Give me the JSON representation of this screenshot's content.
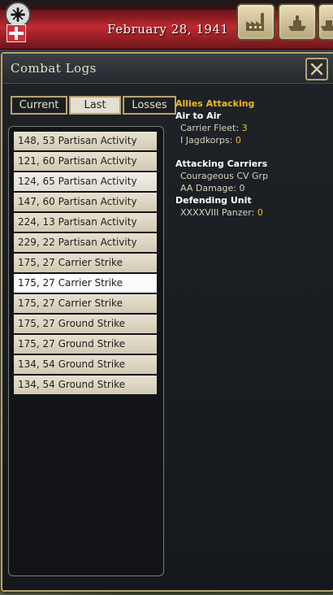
{
  "topbar": {
    "date": "February 28, 1941",
    "icons": [
      "iron-cross-icon",
      "nation-flag-icon",
      "factory-icon",
      "warship-icon",
      "ship-icon"
    ]
  },
  "panel": {
    "title": "Combat Logs",
    "close_icon": "close-x-icon"
  },
  "tabs": [
    {
      "label": "Current",
      "active": false
    },
    {
      "label": "Last",
      "active": true
    },
    {
      "label": "Losses",
      "active": false
    }
  ],
  "logs": [
    {
      "label": "148, 53 Partisan Activity"
    },
    {
      "label": "121, 60 Partisan Activity"
    },
    {
      "label": "124, 65 Partisan Activity"
    },
    {
      "label": "147, 60 Partisan Activity"
    },
    {
      "label": "224, 13 Partisan Activity"
    },
    {
      "label": "229, 22 Partisan Activity"
    },
    {
      "label": "175, 27 Carrier Strike"
    },
    {
      "label": "175, 27 Carrier Strike"
    },
    {
      "label": "175, 27 Carrier Strike"
    },
    {
      "label": "175, 27 Ground Strike"
    },
    {
      "label": "175, 27 Ground Strike"
    },
    {
      "label": "134, 54 Ground Strike"
    },
    {
      "label": "134, 54 Ground Strike"
    }
  ],
  "details": {
    "attacker": "Allies Attacking",
    "phase": "Air to Air",
    "carrier_fleet_label": "Carrier Fleet:",
    "carrier_fleet_value": "3",
    "jagdkorps_label": "I Jagdkorps:",
    "jagdkorps_value": "0",
    "attacking_carriers_title": "Attacking Carriers",
    "carrier_group": "Courageous CV Grp",
    "aa_damage": "AA Damage: 0",
    "defending_title": "Defending Unit",
    "defender_label": "XXXXVIII Panzer:",
    "defender_value": "0"
  },
  "colors": {
    "accent_gold": "#f0b828",
    "frame_gold": "#b8a370",
    "topbar_red": "#c02a31"
  }
}
